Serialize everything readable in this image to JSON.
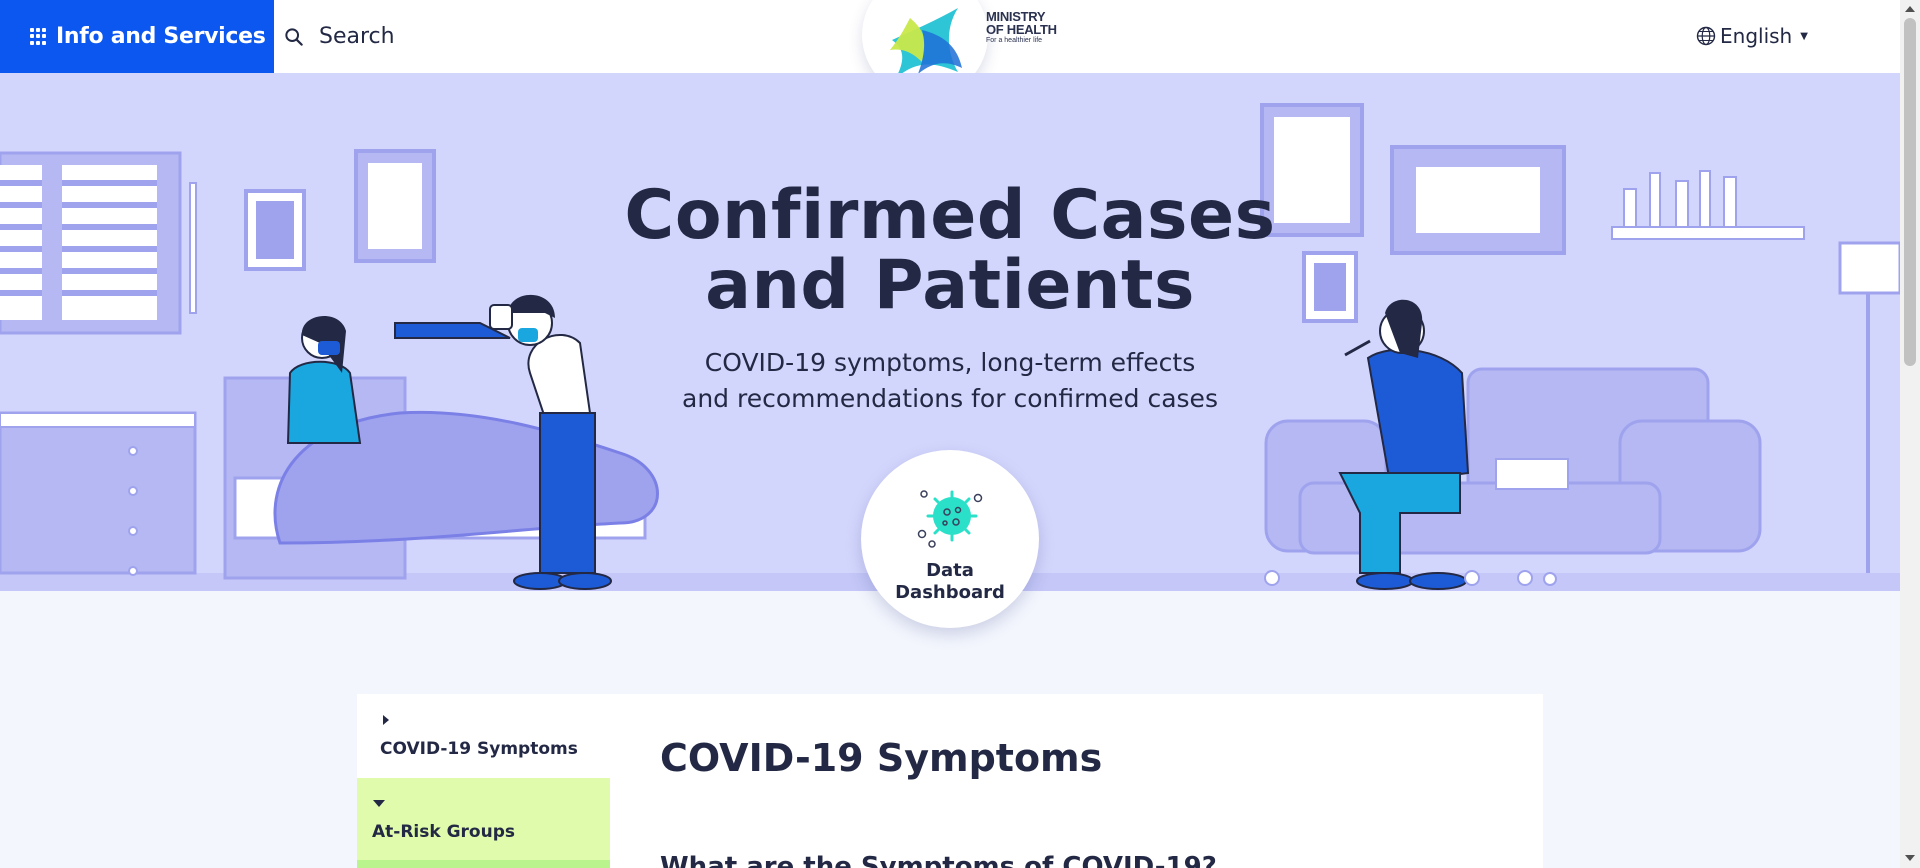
{
  "header": {
    "menu_label": "Info and Services",
    "search_label": "Search",
    "logo_line1": "MINISTRY",
    "logo_line2": "OF HEALTH",
    "logo_tagline": "For a healthier life",
    "language": "English"
  },
  "hero": {
    "title_line1": "Confirmed Cases",
    "title_line2": "and Patients",
    "subtitle_line1": "COVID-19 symptoms, long-term effects",
    "subtitle_line2": "and recommendations for confirmed cases",
    "dashboard_line1": "Data",
    "dashboard_line2": "Dashboard"
  },
  "sidenav": {
    "items": [
      {
        "label": "COVID-19 Symptoms",
        "expanded": false
      },
      {
        "label": "At-Risk Groups",
        "expanded": true,
        "active": true
      }
    ]
  },
  "main": {
    "heading": "COVID-19 Symptoms",
    "subheading": "What are the Symptoms of COVID-19?"
  },
  "colors": {
    "brand_blue": "#0b57f0",
    "hero_bg": "#d3d6fc",
    "active_nav": "#dffbab",
    "text_dark": "#232944"
  },
  "icons": [
    "apps-grid-icon",
    "search-icon",
    "globe-icon",
    "caret-down-icon",
    "virus-icon",
    "chevron-right-icon",
    "chevron-down-icon"
  ]
}
